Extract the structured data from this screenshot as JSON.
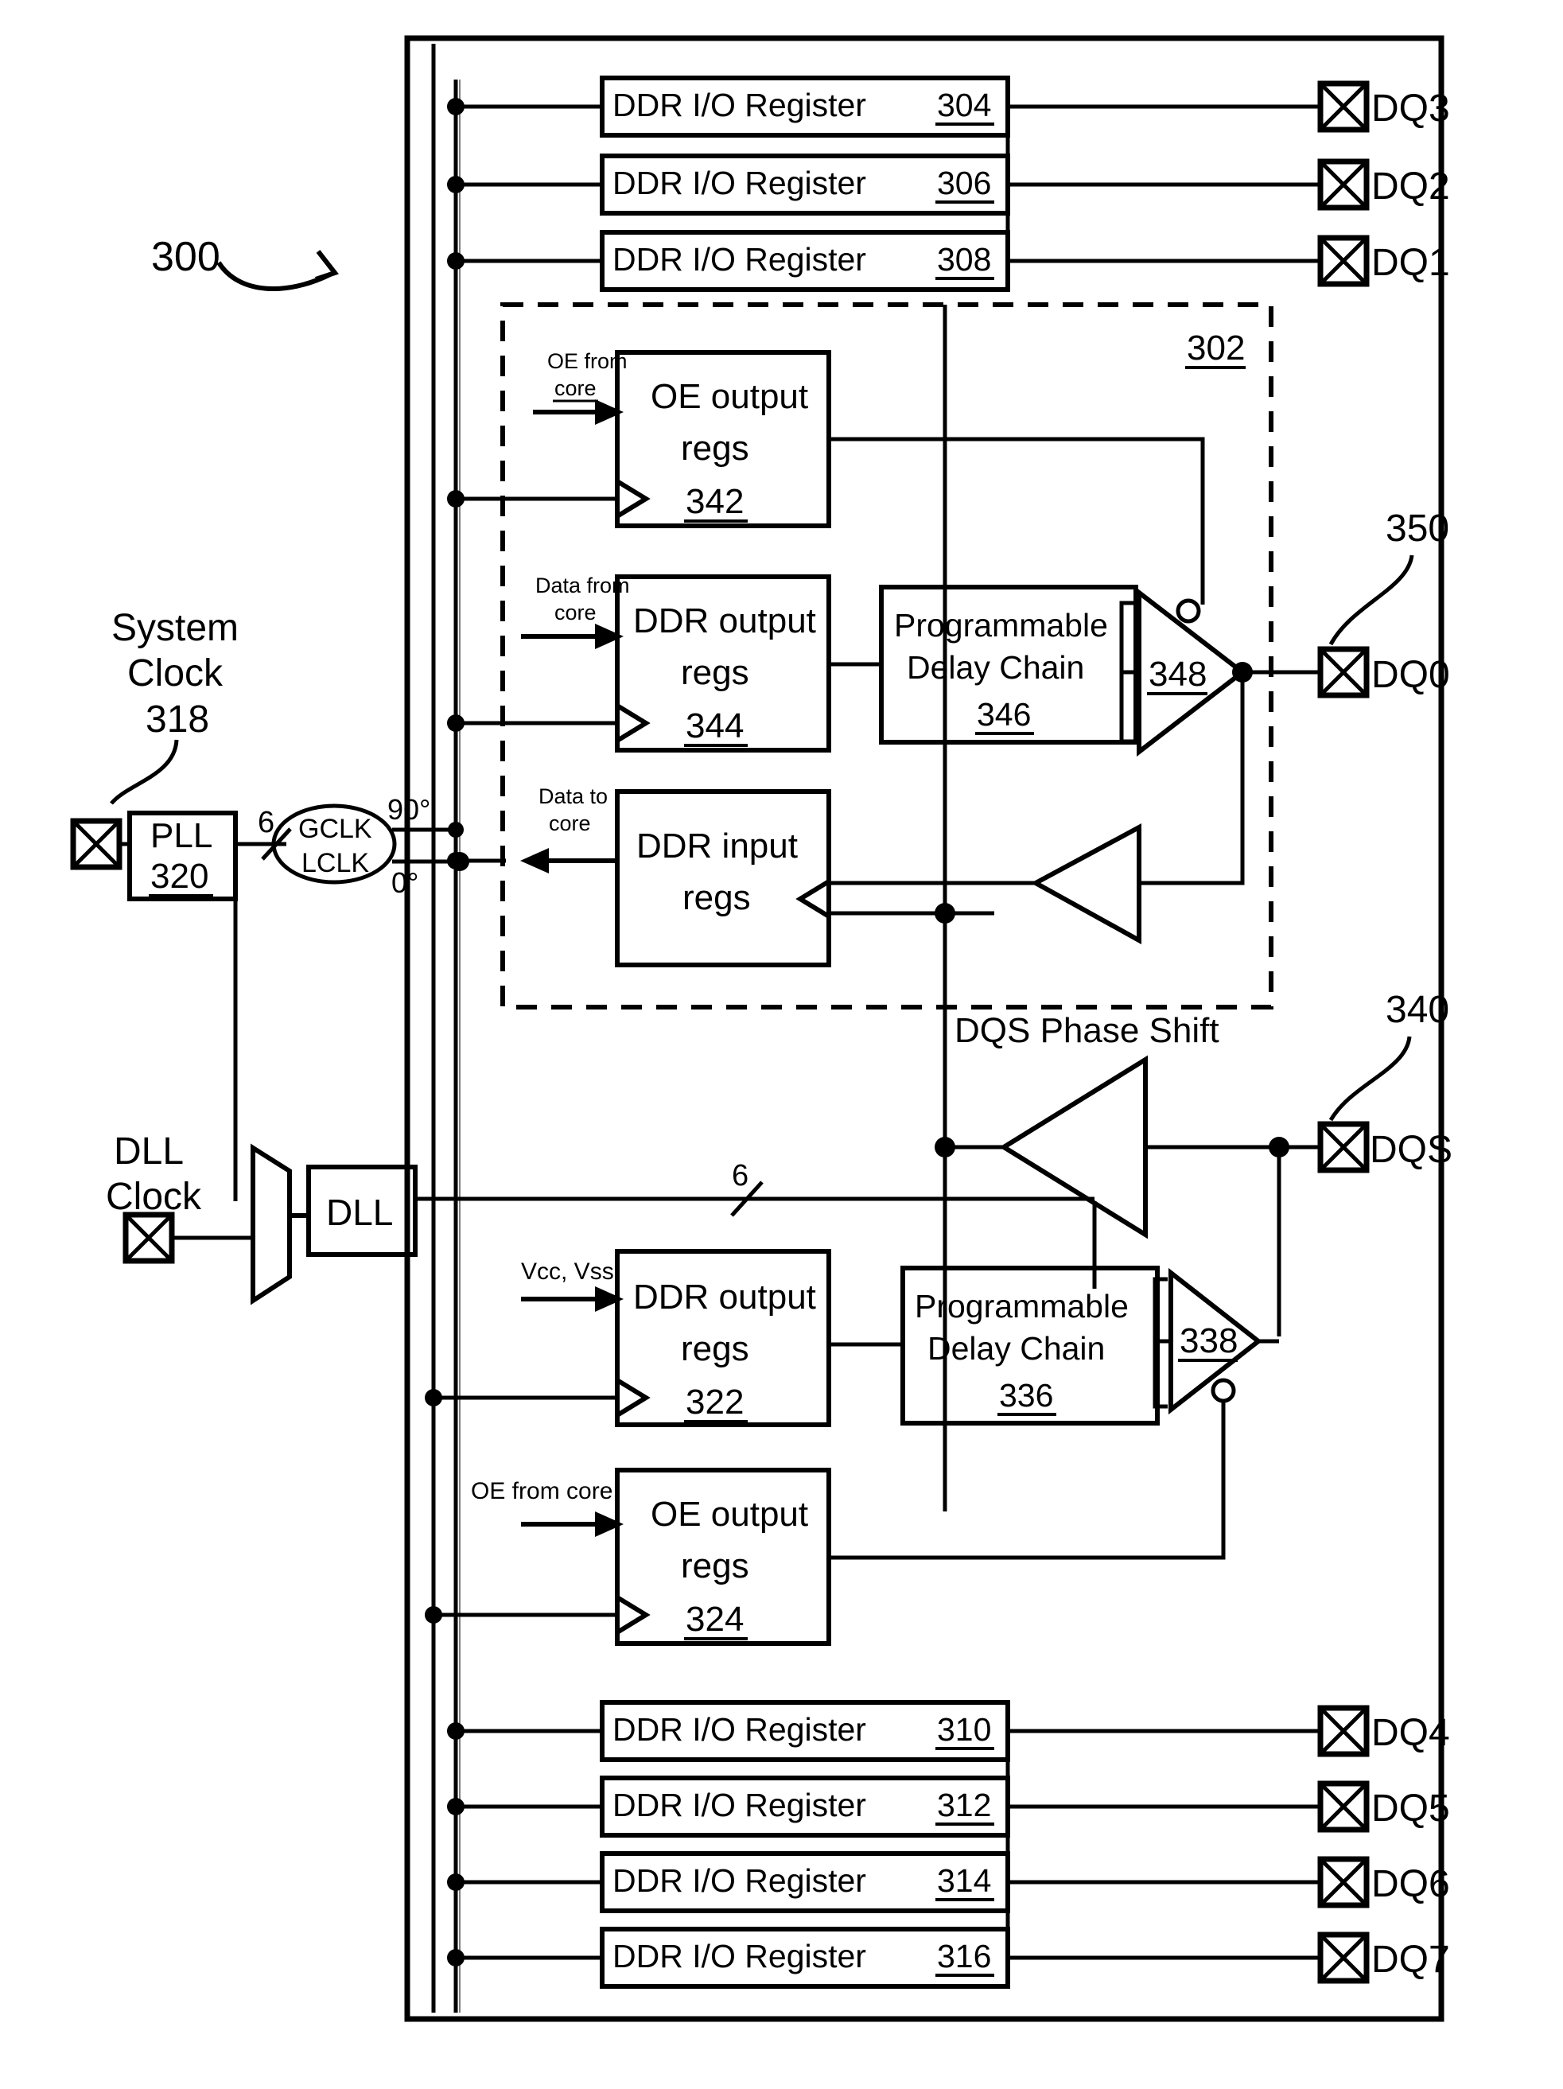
{
  "figure": {
    "ref_main": "300",
    "ref_dashed_block": "302",
    "ref_dq0_pad": "350",
    "ref_dqs_pad": "340"
  },
  "clocks": {
    "system_clock_label_line1": "System",
    "system_clock_label_line2": "Clock",
    "system_clock_ref": "318",
    "pll_label": "PLL",
    "pll_ref": "320",
    "pll_bus_width": "6",
    "clock_net_line1": "GCLK",
    "clock_net_line2": "LCLK",
    "phase_90": "90°",
    "phase_0": "0°",
    "dll_clock_label_line1": "DLL",
    "dll_clock_label_line2": "Clock",
    "dll_label": "DLL",
    "dll_bus_width": "6"
  },
  "io_registers_top": [
    {
      "label": "DDR I/O Register",
      "ref": "304",
      "pad": "DQ3"
    },
    {
      "label": "DDR I/O Register",
      "ref": "306",
      "pad": "DQ2"
    },
    {
      "label": "DDR I/O Register",
      "ref": "308",
      "pad": "DQ1"
    }
  ],
  "io_registers_bottom": [
    {
      "label": "DDR I/O Register",
      "ref": "310",
      "pad": "DQ4"
    },
    {
      "label": "DDR I/O Register",
      "ref": "312",
      "pad": "DQ5"
    },
    {
      "label": "DDR I/O Register",
      "ref": "314",
      "pad": "DQ6"
    },
    {
      "label": "DDR I/O Register",
      "ref": "316",
      "pad": "DQ7"
    }
  ],
  "dq0_block": {
    "oe_regs": {
      "line1": "OE output",
      "line2": "regs",
      "ref": "342",
      "input_line1": "OE from",
      "input_line2": "core"
    },
    "ddr_out_regs": {
      "line1": "DDR output",
      "line2": "regs",
      "ref": "344",
      "input_line1": "Data from",
      "input_line2": "core"
    },
    "delay_chain": {
      "line1": "Programmable",
      "line2": "Delay Chain",
      "ref": "346"
    },
    "tristate_buffer_ref": "348",
    "ddr_in_regs": {
      "line1": "DDR input",
      "line2": "regs",
      "output_line1": "Data to",
      "output_line2": "core"
    },
    "pad": "DQ0"
  },
  "dqs_block": {
    "phase_shift_label": "DQS Phase Shift",
    "pad": "DQS",
    "ddr_out_regs": {
      "line1": "DDR output",
      "line2": "regs",
      "ref": "322",
      "input_label": "Vcc, Vss"
    },
    "delay_chain": {
      "line1": "Programmable",
      "line2": "Delay Chain",
      "ref": "336"
    },
    "tristate_buffer_ref": "338",
    "oe_regs": {
      "line1": "OE output",
      "line2": "regs",
      "ref": "324",
      "input_label": "OE from core"
    }
  },
  "style": {
    "line_color": "#000000",
    "background": "#ffffff"
  }
}
